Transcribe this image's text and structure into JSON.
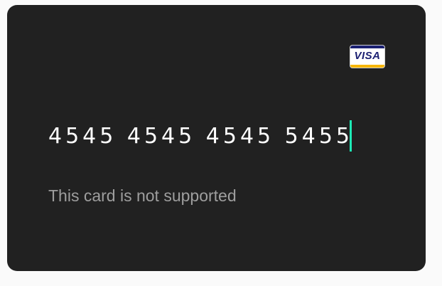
{
  "card": {
    "brand": "VISA",
    "number_value": "4545 4545 4545 5455",
    "error_message": "This card is not supported"
  },
  "colors": {
    "card_background": "#212121",
    "caret_accent": "#1de9b6",
    "error_text": "#9e9e9e",
    "number_text": "#ffffff"
  },
  "icons": {
    "brand_logo": "visa-logo-icon"
  }
}
